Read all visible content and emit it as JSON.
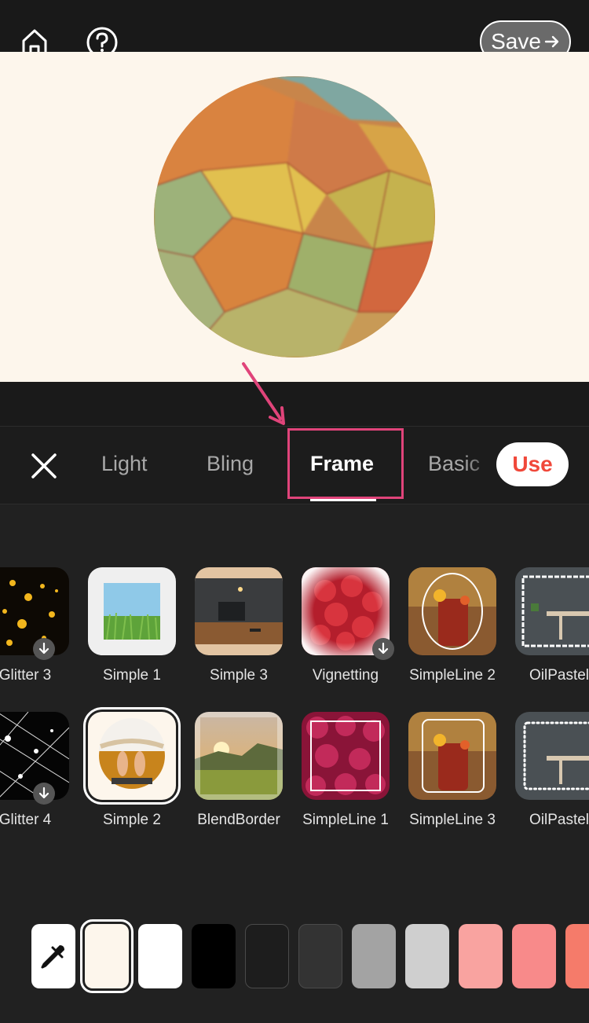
{
  "header": {
    "home_icon": "home-icon",
    "help_icon": "help-icon",
    "save_label": "Save"
  },
  "tabs": {
    "items": [
      "Light",
      "Bling",
      "Frame",
      "Basic"
    ],
    "active": "Frame",
    "use_label": "Use"
  },
  "frames": {
    "row1": [
      "Glitter 3",
      "Simple 1",
      "Simple 3",
      "Vignetting",
      "SimpleLine 2",
      "OilPastel"
    ],
    "row2": [
      "Glitter 4",
      "Simple 2",
      "BlendBorder",
      "SimpleLine 1",
      "SimpleLine 3",
      "OilPastel"
    ],
    "selected": "Simple 2"
  },
  "colors": {
    "swatches": [
      "#fdf6ec",
      "#ffffff",
      "#000000",
      "#1d1d1d",
      "#333333",
      "#a3a3a3",
      "#cfcfcf",
      "#f9a3a0",
      "#f88a8a",
      "#f57b6a"
    ],
    "selected": "#fdf6ec",
    "annotation": "#e0447a",
    "use_text": "#f0483a"
  }
}
